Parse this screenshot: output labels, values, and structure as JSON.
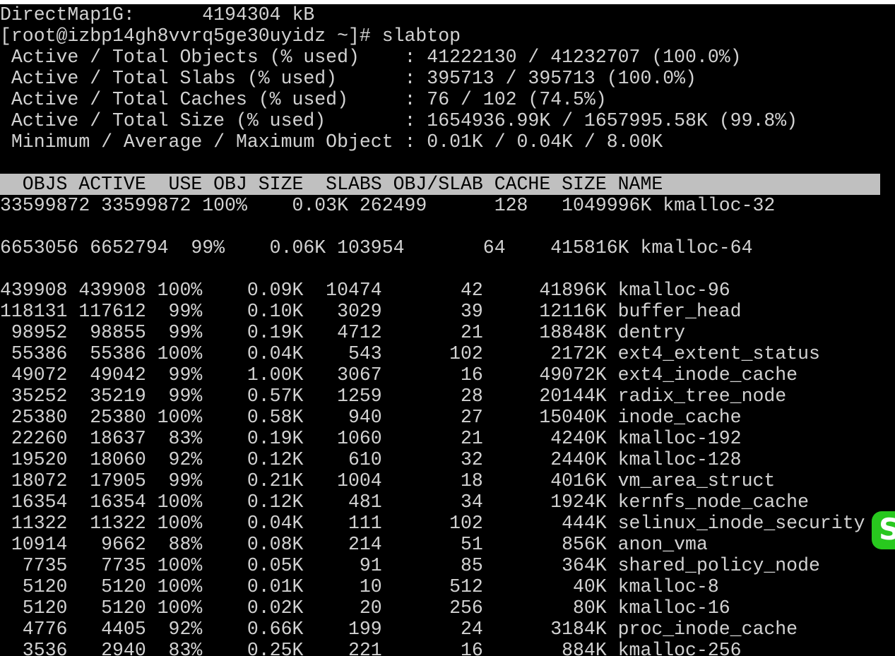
{
  "terminal": {
    "bg_color": "#000000",
    "fg_color": "#d2d2d2",
    "header_bg_color": "#c0c0c0",
    "lines": [
      "DirectMap1G:      4194304 kB",
      "[root@izbp14gh8vvrq5ge30uyidz ~]# slabtop",
      " Active / Total Objects (% used)    : 41222130 / 41232707 (100.0%)",
      " Active / Total Slabs (% used)      : 395713 / 395713 (100.0%)",
      " Active / Total Caches (% used)     : 76 / 102 (74.5%)",
      " Active / Total Size (% used)       : 1654936.99K / 1657995.58K (99.8%)",
      " Minimum / Average / Maximum Object : 0.01K / 0.04K / 8.00K",
      "",
      "  OBJS ACTIVE  USE OBJ SIZE  SLABS OBJ/SLAB CACHE SIZE NAME",
      "33599872 33599872 100%    0.03K 262499      128   1049996K kmalloc-32",
      "",
      "6653056 6652794  99%    0.06K 103954       64    415816K kmalloc-64",
      "",
      "439908 439908 100%    0.09K  10474       42     41896K kmalloc-96",
      "118131 117612  99%    0.10K   3029       39     12116K buffer_head",
      " 98952  98855  99%    0.19K   4712       21     18848K dentry",
      " 55386  55386 100%    0.04K    543      102      2172K ext4_extent_status",
      " 49072  49042  99%    1.00K   3067       16     49072K ext4_inode_cache",
      " 35252  35219  99%    0.57K   1259       28     20144K radix_tree_node",
      " 25380  25380 100%    0.58K    940       27     15040K inode_cache",
      " 22260  18637  83%    0.19K   1060       21      4240K kmalloc-192",
      " 19520  18060  92%    0.12K    610       32      2440K kmalloc-128",
      " 18072  17905  99%    0.21K   1004       18      4016K vm_area_struct",
      " 16354  16354 100%    0.12K    481       34      1924K kernfs_node_cache",
      " 11322  11322 100%    0.04K    111      102       444K selinux_inode_security",
      " 10914   9662  88%    0.08K    214       51       856K anon_vma",
      "  7735   7735 100%    0.05K     91       85       364K shared_policy_node",
      "  5120   5120 100%    0.01K     10      512        40K kmalloc-8",
      "  5120   5120 100%    0.02K     20      256        80K kmalloc-16",
      "  4776   4405  92%    0.66K    199       24      3184K proc_inode_cache",
      "  3536   2940  83%    0.25K    221       16       884K kmalloc-256"
    ]
  },
  "overlay": {
    "badge_icon": "green-app-badge-icon",
    "badge_color": "#28c81e",
    "badge_glyph": "S"
  }
}
